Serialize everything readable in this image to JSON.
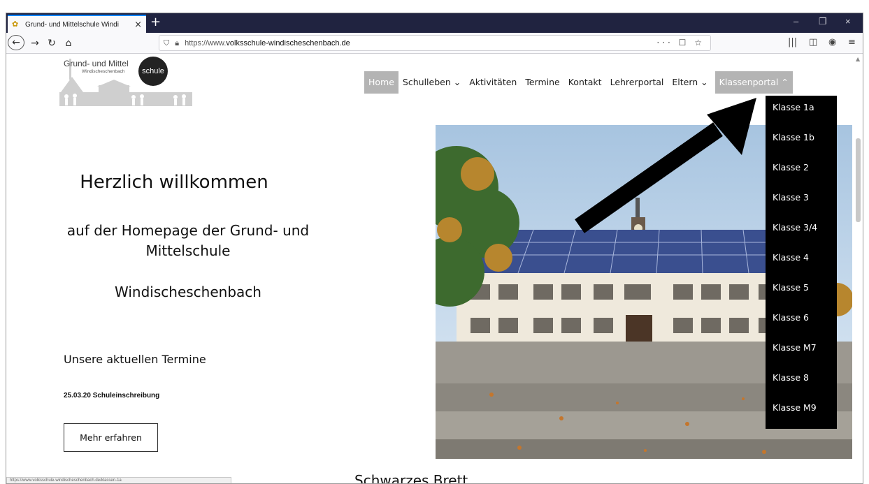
{
  "browser": {
    "tab_title": "Grund- und Mittelschule Windi",
    "url_prefix": "https://www.",
    "url_domain": "volksschule-windischeschenbach.de",
    "new_tab": "+",
    "close_tab": "×",
    "window_controls": [
      "–",
      "❐",
      "×"
    ]
  },
  "logo": {
    "line1": "Grund- und Mittel",
    "line2": "Windischeschenbach",
    "badge": "schule"
  },
  "nav": {
    "items": [
      {
        "label": "Home"
      },
      {
        "label": "Schulleben ⌄"
      },
      {
        "label": "Aktivitäten"
      },
      {
        "label": "Termine"
      },
      {
        "label": "Kontakt"
      },
      {
        "label": "Lehrerportal"
      },
      {
        "label": "Eltern ⌄"
      },
      {
        "label": "Klassenportal ⌃"
      }
    ]
  },
  "dropdown": {
    "items": [
      "Klasse 1a",
      "Klasse 1b",
      "Klasse 2",
      "Klasse 3",
      "Klasse 3/4",
      "Klasse 4",
      "Klasse 5",
      "Klasse 6",
      "Klasse M7",
      "Klasse 8",
      "Klasse M9"
    ]
  },
  "content": {
    "welcome": "Herzlich willkommen",
    "subtitle": "auf der Homepage der Grund- und Mittelschule",
    "town": "Windischeschenbach",
    "termine_heading": "Unsere aktuellen Termine",
    "termin_1": "25.03.20 Schuleinschreibung",
    "more_button": "Mehr erfahren",
    "board_heading": "Schwarzes Brett"
  },
  "status": {
    "link": "https://www.volksschule-windischeschenbach.de/klassen-1a"
  },
  "colors": {
    "tabbar": "#202340",
    "nav_active": "#b4b4b4",
    "dropdown_bg": "#000000",
    "arrow": "#000000"
  }
}
